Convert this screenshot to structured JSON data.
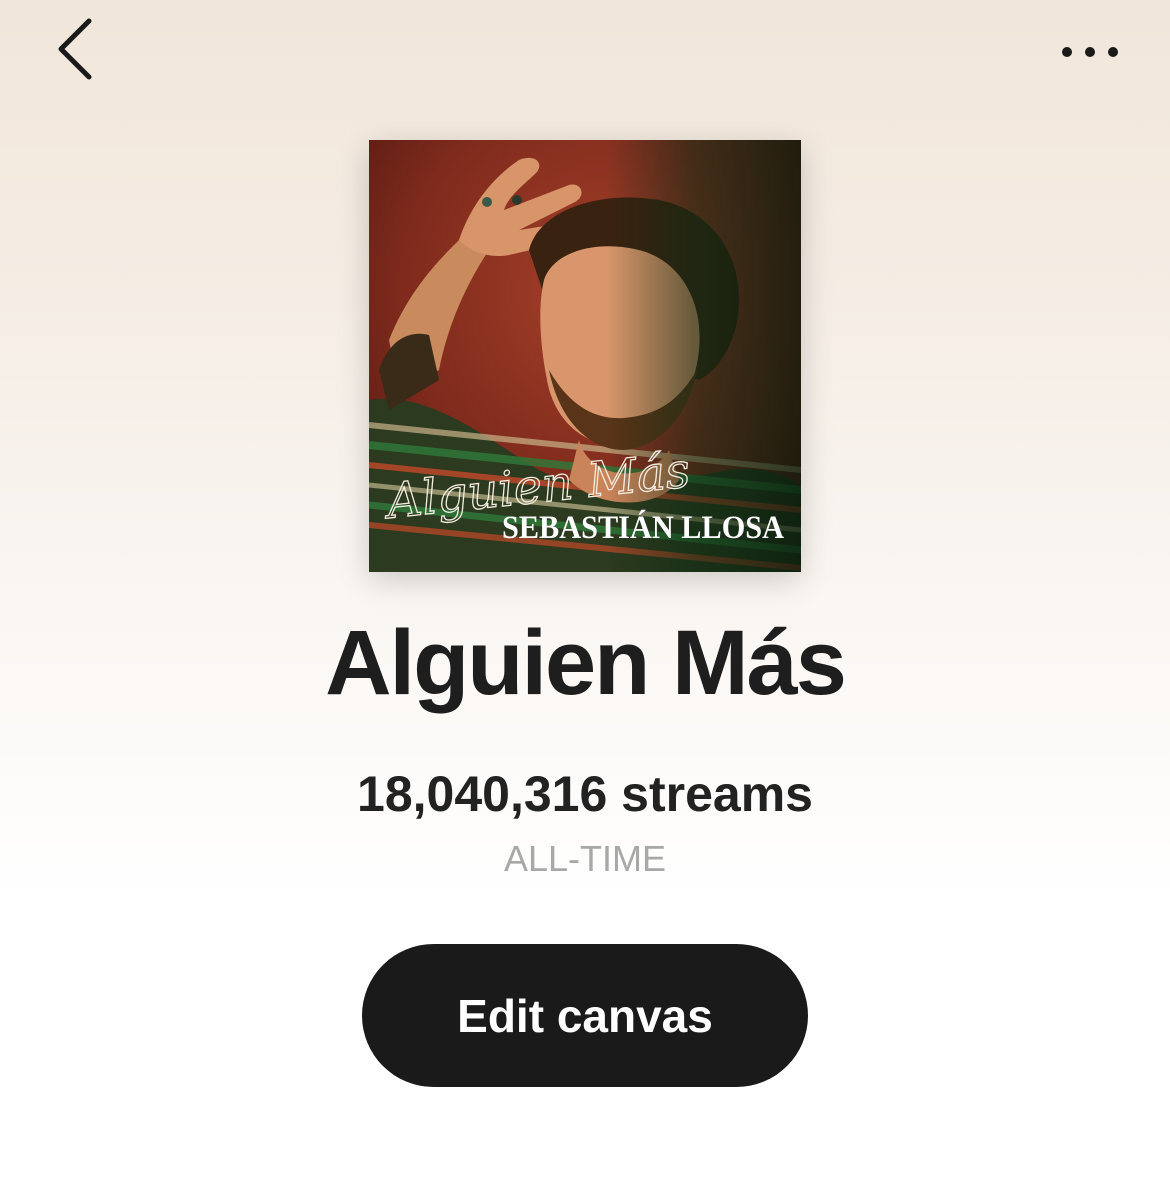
{
  "header": {
    "back_icon": "chevron-left-icon",
    "more_icon": "more-horizontal-icon"
  },
  "artwork": {
    "script_title": "Alguien Más",
    "artist_name": "SEBASTIÁN LLOSA",
    "background_color": "#8a2b1e"
  },
  "track": {
    "title": "Alguien Más"
  },
  "stats": {
    "streams": "18,040,316 streams",
    "period": "ALL-TIME"
  },
  "actions": {
    "edit_canvas_label": "Edit canvas"
  },
  "colors": {
    "button_bg": "#1a1a1a",
    "title_text": "#1e1e1e",
    "muted_text": "#a8a8a8"
  }
}
